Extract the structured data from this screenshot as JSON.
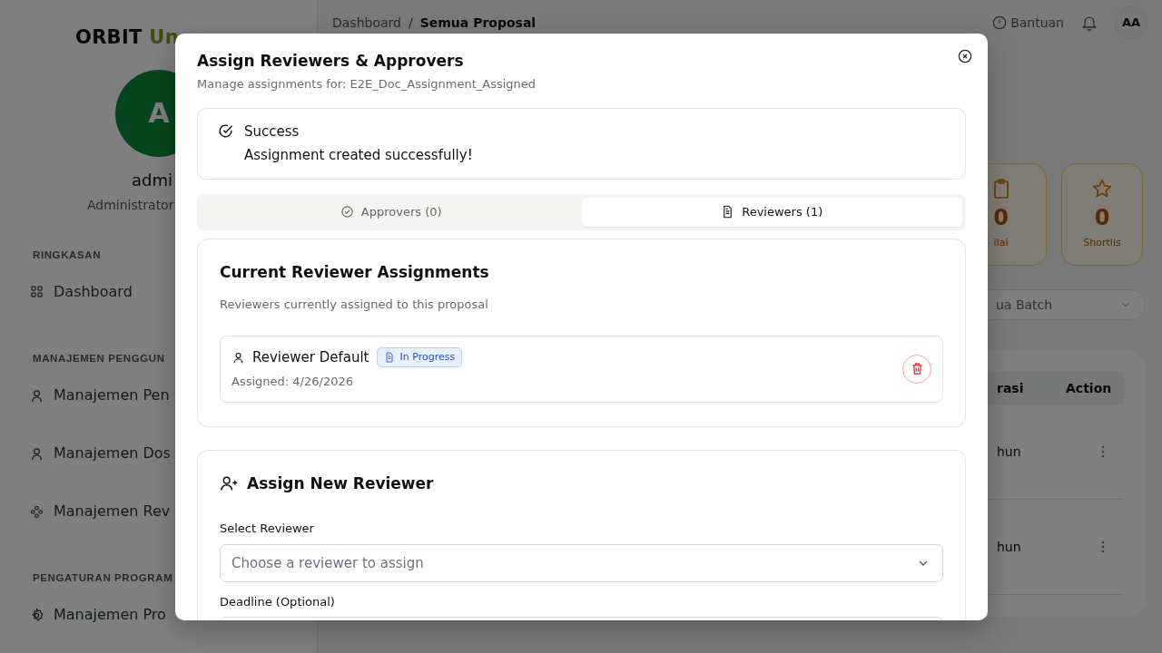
{
  "sidebar": {
    "logo": {
      "primary": "ORBIT",
      "accent": "Un"
    },
    "avatar_initial": "A",
    "user_name": "admi",
    "user_role": "Administrator",
    "sections": [
      {
        "heading": "RINGKASAN",
        "items": [
          {
            "label": "Dashboard"
          }
        ]
      },
      {
        "heading": "MANAJEMEN PENGGUN",
        "items": [
          {
            "label": "Manajemen Pen"
          },
          {
            "label": "Manajemen Dos"
          },
          {
            "label": "Manajemen Rev"
          }
        ]
      },
      {
        "heading": "PENGATURAN PROGRAM",
        "items": [
          {
            "label": "Manajemen Pro"
          }
        ]
      }
    ]
  },
  "header": {
    "breadcrumb": [
      "Dashboard",
      "Semua Proposal"
    ],
    "breadcrumb_separator": "/",
    "help": "Bantuan",
    "avatar": "AA"
  },
  "stats": [
    {
      "value": "0",
      "label": "ilai"
    },
    {
      "value": "0",
      "label": "Shortlis"
    }
  ],
  "batch_filter": {
    "value": "ua Batch"
  },
  "table": {
    "columns": [
      "rasi",
      "Action"
    ],
    "rows": [
      {
        "column_1": "hun"
      },
      {
        "column_1": "hun"
      }
    ]
  },
  "modal": {
    "title": "Assign Reviewers & Approvers",
    "subtitle": "Manage assignments for: E2E_Doc_Assignment_Assigned",
    "alert": {
      "title": "Success",
      "message": "Assignment created successfully!"
    },
    "tabs": [
      {
        "label": "Approvers (0)",
        "selected": false
      },
      {
        "label": "Reviewers (1)",
        "selected": true
      }
    ],
    "current": {
      "title": "Current Reviewer Assignments",
      "description": "Reviewers currently assigned to this proposal",
      "assignments": [
        {
          "name": "Reviewer Default",
          "status": "In Progress",
          "assigned": "Assigned: 4/26/2026"
        }
      ]
    },
    "assign_new": {
      "title": "Assign New Reviewer",
      "fields": [
        {
          "label": "Select Reviewer",
          "kind": "select",
          "placeholder": "Choose a reviewer to assign"
        },
        {
          "label": "Deadline (Optional)",
          "kind": "date"
        }
      ]
    }
  }
}
